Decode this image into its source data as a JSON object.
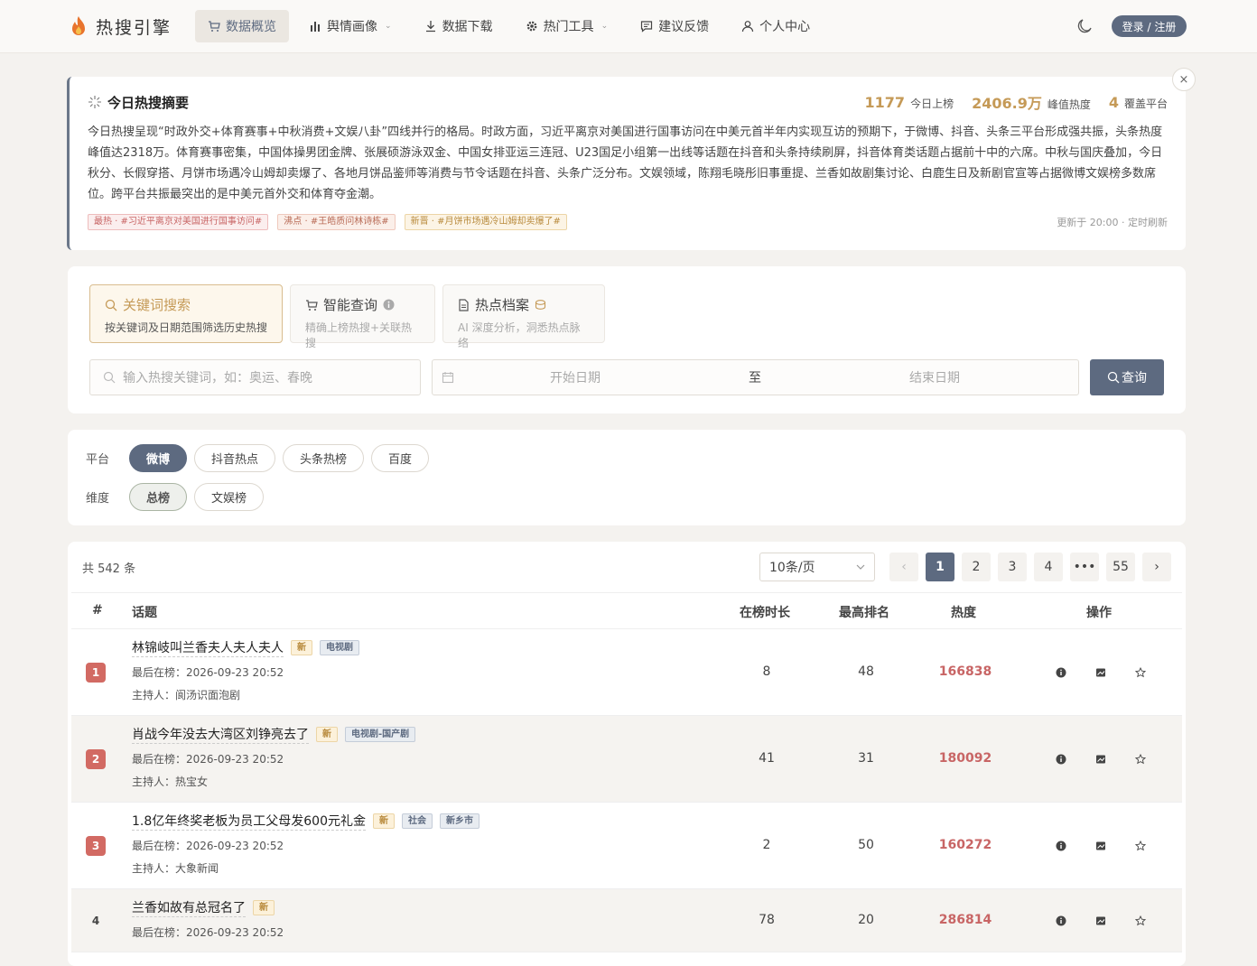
{
  "nav": {
    "logo_text": "热搜引擎",
    "items": [
      {
        "label": "数据概览",
        "icon": "cart-icon"
      },
      {
        "label": "舆情画像",
        "icon": "bar-chart-icon",
        "caret": "⌄"
      },
      {
        "label": "数据下载",
        "icon": "download-icon"
      },
      {
        "label": "热门工具",
        "icon": "gear-icon",
        "caret": "⌄"
      },
      {
        "label": "建议反馈",
        "icon": "message-icon"
      },
      {
        "label": "个人中心",
        "icon": "user-icon"
      }
    ],
    "login_label": "登录 / 注册"
  },
  "summary": {
    "title": "今日热搜摘要",
    "stats": [
      {
        "value": "1177",
        "label": "今日上榜"
      },
      {
        "value": "2406.9万",
        "label": "峰值热度"
      },
      {
        "value": "4",
        "label": "覆盖平台"
      }
    ],
    "text": "今日热搜呈现“时政外交+体育赛事+中秋消费+文娱八卦”四线并行的格局。时政方面，习近平离京对美国进行国事访问在中美元首半年内实现互访的预期下，于微博、抖音、头条三平台形成强共振，头条热度峰值达2318万。体育赛事密集，中国体操男团金牌、张展硕游泳双金、中国女排亚运三连冠、U23国足小组第一出线等话题在抖音和头条持续刷屏，抖音体育类话题占据前十中的六席。中秋与国庆叠加，今日秋分、长假穿搭、月饼市场遇冷山姆却卖爆了、各地月饼品鉴师等消费与节令话题在抖音、头条广泛分布。文娱领域，陈翔毛晓彤旧事重提、兰香如故剧集讨论、白鹿生日及新剧官宣等占据微博文娱榜多数席位。跨平台共振最突出的是中美元首外交和体育夺金潮。",
    "tags": [
      {
        "text": "最热 · #习近平离京对美国进行国事访问#",
        "kind": "hot"
      },
      {
        "text": "沸点 · #王皓质问林诗栋#",
        "kind": "boil"
      },
      {
        "text": "新晋 · #月饼市场遇冷山姆却卖爆了#",
        "kind": "new"
      }
    ],
    "update": "更新于 20:00 · 定时刷新",
    "close": "×"
  },
  "search": {
    "modes": [
      {
        "title": "关键词搜索",
        "sub": "按关键词及日期范围筛选历史热搜",
        "icon": "search-icon"
      },
      {
        "title": "智能查询",
        "sub": "精确上榜热搜+关联热搜",
        "icon": "cart-icon",
        "extra": "info-icon"
      },
      {
        "title": "热点档案",
        "sub": "AI 深度分析，洞悉热点脉络",
        "icon": "document-icon",
        "extra": "coin-icon"
      }
    ],
    "keyword_placeholder": "输入热搜关键词，如：奥运、春晚",
    "start_date": "开始日期",
    "to": "至",
    "end_date": "结束日期",
    "query_label": "查询"
  },
  "filters": {
    "platform_label": "平台",
    "platforms": [
      "微博",
      "抖音热点",
      "头条热榜",
      "百度"
    ],
    "dimension_label": "维度",
    "dimensions": [
      "总榜",
      "文娱榜"
    ]
  },
  "table": {
    "total": "共 542 条",
    "page_size": "10条/页",
    "pages": [
      "1",
      "2",
      "3",
      "4",
      "•••",
      "55"
    ],
    "prev": "‹",
    "next": "›",
    "headers": {
      "index": "#",
      "topic": "话题",
      "duration": "在榜时长",
      "best_rank": "最高排名",
      "heat": "热度",
      "ops": "操作"
    },
    "rows": [
      {
        "rank": "1",
        "title": "林锦岐叫兰香夫人夫人夫人",
        "badges": [
          {
            "text": "新",
            "kind": "new"
          },
          {
            "text": "电视剧",
            "kind": "cat"
          }
        ],
        "last": "最后在榜：2026-09-23 20:52",
        "host": "主持人：阆汤识面泡剧",
        "duration": "8",
        "best": "48",
        "heat": "166838"
      },
      {
        "rank": "2",
        "title": "肖战今年没去大湾区刘铮亮去了",
        "badges": [
          {
            "text": "新",
            "kind": "new"
          },
          {
            "text": "电视剧-国产剧",
            "kind": "cat"
          }
        ],
        "last": "最后在榜：2026-09-23 20:52",
        "host": "主持人：热宝女",
        "duration": "41",
        "best": "31",
        "heat": "180092"
      },
      {
        "rank": "3",
        "title": "1.8亿年终奖老板为员工父母发600元礼金",
        "badges": [
          {
            "text": "新",
            "kind": "new"
          },
          {
            "text": "社会",
            "kind": "cat"
          },
          {
            "text": "新乡市",
            "kind": "cat"
          }
        ],
        "last": "最后在榜：2026-09-23 20:52",
        "host": "主持人：大象新闻",
        "duration": "2",
        "best": "50",
        "heat": "160272"
      },
      {
        "rank": "4",
        "title": "兰香如故有总冠名了",
        "badges": [
          {
            "text": "新",
            "kind": "new"
          }
        ],
        "last": "最后在榜：2026-09-23 20:52",
        "host": "",
        "duration": "78",
        "best": "20",
        "heat": "286814"
      }
    ],
    "op_icons": [
      "info-icon",
      "chart-icon",
      "star-icon"
    ]
  }
}
